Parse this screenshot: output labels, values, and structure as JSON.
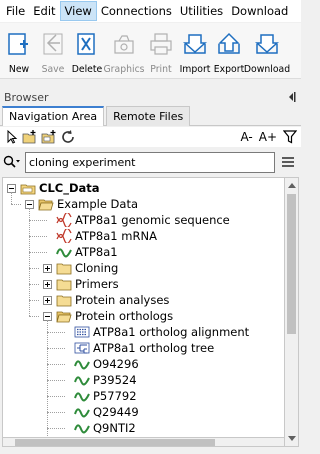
{
  "menu": {
    "items": [
      "File",
      "Edit",
      "View",
      "Connections",
      "Utilities",
      "Download"
    ],
    "active_index": 2
  },
  "toolbar": {
    "buttons": [
      {
        "label": "New",
        "icon": "new-icon",
        "enabled": true
      },
      {
        "label": "Save",
        "icon": "save-icon",
        "enabled": false
      },
      {
        "label": "Delete",
        "icon": "delete-icon",
        "enabled": true
      },
      {
        "label": "Graphics",
        "icon": "graphics-icon",
        "enabled": false
      },
      {
        "label": "Print",
        "icon": "print-icon",
        "enabled": false
      },
      {
        "label": "Import",
        "icon": "import-icon",
        "enabled": true
      },
      {
        "label": "Export",
        "icon": "export-icon",
        "enabled": true
      },
      {
        "label": "Download",
        "icon": "download-icon",
        "enabled": true
      }
    ]
  },
  "browser": {
    "title": "Browser",
    "tabs": [
      "Navigation Area",
      "Remote Files"
    ],
    "selected_tab": 0
  },
  "nav_toolbar": {
    "decrease_font": "A-",
    "increase_font": "A+"
  },
  "search": {
    "value": "cloning experiment",
    "placeholder": ""
  },
  "tree": [
    {
      "label": "CLC_Data",
      "level": 0,
      "expander": "minus",
      "icon": "database-icon",
      "bold": true
    },
    {
      "label": "Example Data",
      "level": 1,
      "expander": "minus",
      "icon": "folder-open-icon"
    },
    {
      "label": "ATP8a1 genomic sequence",
      "level": 2,
      "expander": "none",
      "icon": "sequence-icon"
    },
    {
      "label": "ATP8a1 mRNA",
      "level": 2,
      "expander": "none",
      "icon": "sequence-icon"
    },
    {
      "label": "ATP8a1",
      "level": 2,
      "expander": "none",
      "icon": "protein-icon"
    },
    {
      "label": "Cloning",
      "level": 2,
      "expander": "plus",
      "icon": "folder-icon"
    },
    {
      "label": "Primers",
      "level": 2,
      "expander": "plus",
      "icon": "folder-icon"
    },
    {
      "label": "Protein analyses",
      "level": 2,
      "expander": "plus",
      "icon": "folder-icon"
    },
    {
      "label": "Protein orthologs",
      "level": 2,
      "expander": "minus",
      "icon": "folder-open-icon"
    },
    {
      "label": "ATP8a1 ortholog alignment",
      "level": 3,
      "expander": "none",
      "icon": "alignment-icon"
    },
    {
      "label": "ATP8a1 ortholog tree",
      "level": 3,
      "expander": "none",
      "icon": "tree-icon"
    },
    {
      "label": "O94296",
      "level": 3,
      "expander": "none",
      "icon": "protein-icon"
    },
    {
      "label": "P39524",
      "level": 3,
      "expander": "none",
      "icon": "protein-icon"
    },
    {
      "label": "P57792",
      "level": 3,
      "expander": "none",
      "icon": "protein-icon"
    },
    {
      "label": "Q29449",
      "level": 3,
      "expander": "none",
      "icon": "protein-icon"
    },
    {
      "label": "Q9NTI2",
      "level": 3,
      "expander": "none",
      "icon": "protein-icon"
    }
  ],
  "colors": {
    "accent": "#3d7fd0",
    "folder": "#e0c060",
    "dna": "#c0392b",
    "protein": "#2e8b3a"
  }
}
